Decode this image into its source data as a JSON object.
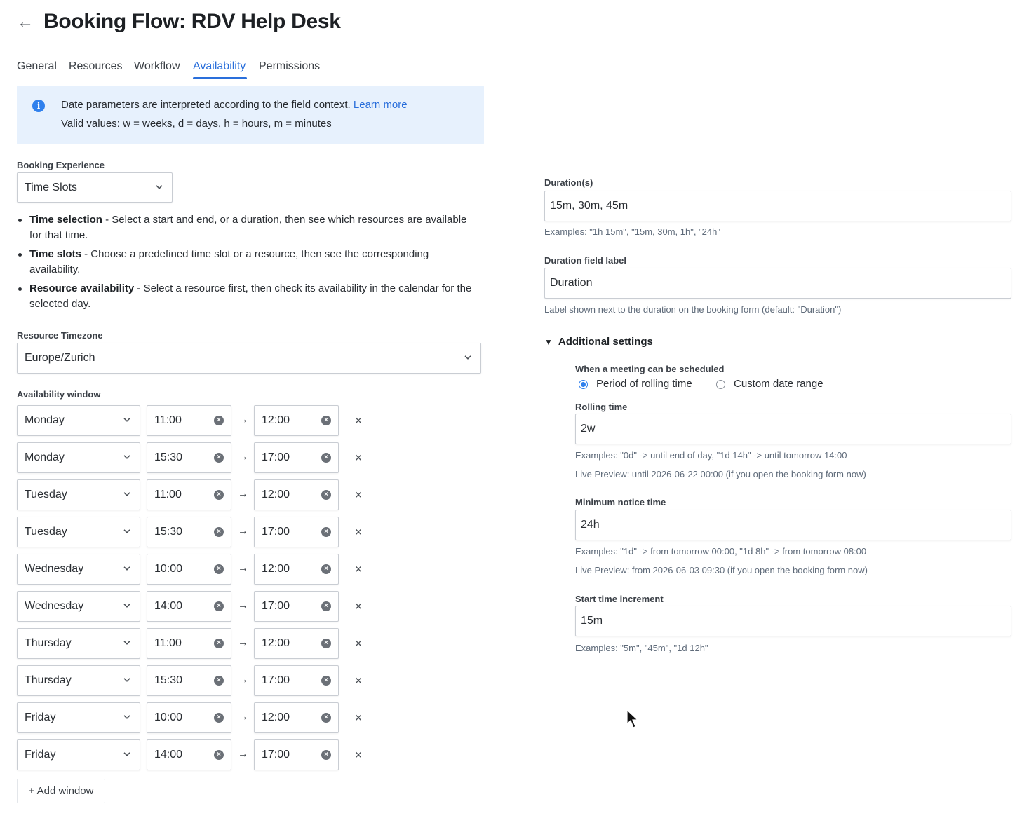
{
  "header": {
    "back_icon": "arrow-left-icon",
    "title": "Booking Flow: RDV Help Desk"
  },
  "tabs": [
    {
      "label": "General",
      "active": false
    },
    {
      "label": "Resources",
      "active": false
    },
    {
      "label": "Workflow",
      "active": false
    },
    {
      "label": "Availability",
      "active": true
    },
    {
      "label": "Permissions",
      "active": false
    }
  ],
  "info": {
    "icon": "info-icon",
    "text": "Date parameters are interpreted according to the field context.",
    "link": "Learn more",
    "valid_values": "Valid values: w = weeks, d = days, h = hours, m = minutes"
  },
  "booking_experience": {
    "label": "Booking Experience",
    "value": "Time Slots"
  },
  "bullets": [
    {
      "term": "Time selection",
      "text": " - Select a start and end, or a duration, then see which resources are available for that time."
    },
    {
      "term": "Time slots",
      "text": " - Choose a predefined time slot or a resource, then see the corresponding availability."
    },
    {
      "term": "Resource availability",
      "text": " - Select a resource first, then check its availability in the calendar for the selected day."
    }
  ],
  "timezone": {
    "label": "Resource Timezone",
    "value": "Europe/Zurich"
  },
  "availability": {
    "label": "Availability window",
    "rows": [
      {
        "day": "Monday",
        "start": "11:00",
        "end": "12:00"
      },
      {
        "day": "Monday",
        "start": "15:30",
        "end": "17:00"
      },
      {
        "day": "Tuesday",
        "start": "11:00",
        "end": "12:00"
      },
      {
        "day": "Tuesday",
        "start": "15:30",
        "end": "17:00"
      },
      {
        "day": "Wednesday",
        "start": "10:00",
        "end": "12:00"
      },
      {
        "day": "Wednesday",
        "start": "14:00",
        "end": "17:00"
      },
      {
        "day": "Thursday",
        "start": "11:00",
        "end": "12:00"
      },
      {
        "day": "Thursday",
        "start": "15:30",
        "end": "17:00"
      },
      {
        "day": "Friday",
        "start": "10:00",
        "end": "12:00"
      },
      {
        "day": "Friday",
        "start": "14:00",
        "end": "17:00"
      }
    ],
    "add_label": "+ Add window"
  },
  "durations": {
    "label": "Duration(s)",
    "value": "15m, 30m, 45m",
    "help": "Examples: \"1h 15m\", \"15m, 30m, 1h\", \"24h\""
  },
  "duration_label": {
    "label": "Duration field label",
    "value": "Duration",
    "help": "Label shown next to the duration on the booking form (default: \"Duration\")"
  },
  "additional": {
    "title": "Additional settings",
    "schedule_label": "When a meeting can be scheduled",
    "options": [
      {
        "label": "Period of rolling time",
        "checked": true
      },
      {
        "label": "Custom date range",
        "checked": false
      }
    ],
    "rolling_time": {
      "label": "Rolling time",
      "value": "2w",
      "help1": "Examples: \"0d\" -> until end of day, \"1d 14h\" -> until tomorrow 14:00",
      "help2": "Live Preview: until 2026-06-22 00:00 (if you open the booking form now)"
    },
    "minimum_notice": {
      "label": "Minimum notice time",
      "value": "24h",
      "help1": "Examples: \"1d\" -> from tomorrow 00:00, \"1d 8h\" -> from tomorrow 08:00",
      "help2": "Live Preview: from 2026-06-03 09:30 (if you open the booking form now)"
    },
    "start_increment": {
      "label": "Start time increment",
      "value": "15m",
      "help": "Examples: \"5m\", \"45m\", \"1d 12h\""
    }
  }
}
